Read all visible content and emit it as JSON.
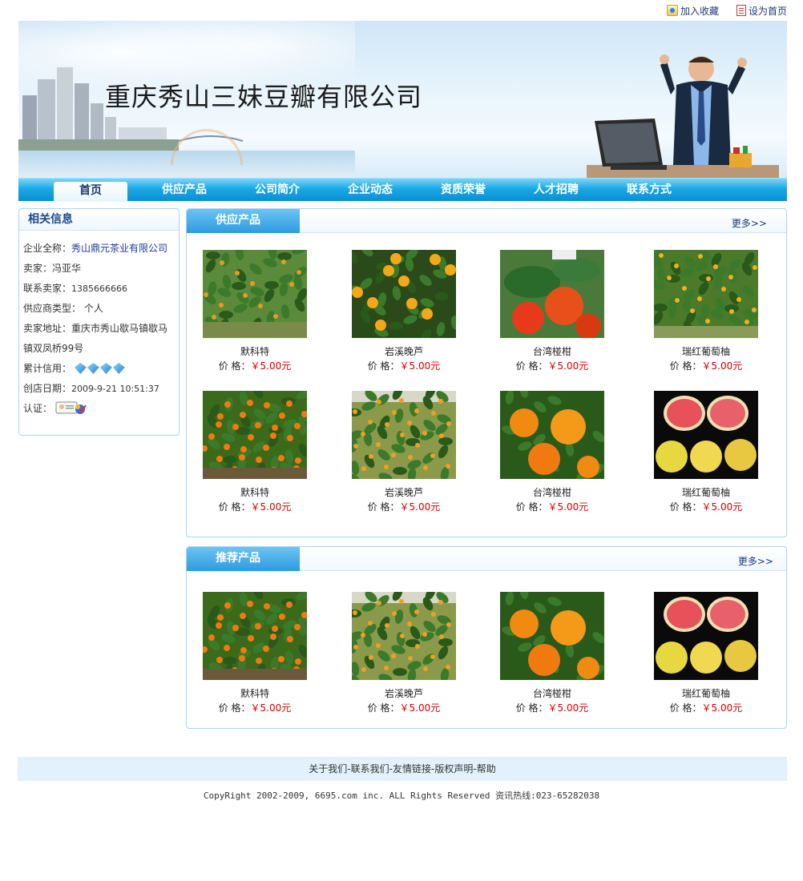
{
  "toplinks": {
    "favorite": "加入收藏",
    "homepage": "设为首页"
  },
  "banner": {
    "company_name": "重庆秀山三妹豆瓣有限公司"
  },
  "nav": [
    "首页",
    "供应产品",
    "公司简介",
    "企业动态",
    "资质荣誉",
    "人才招聘",
    "联系方式"
  ],
  "sidebar": {
    "title": "相关信息",
    "company_label": "企业全称：",
    "company_value": "秀山鼎元茶业有限公司",
    "seller_label": "卖家：",
    "seller_value": "冯亚华",
    "contact_label": "联系卖家：",
    "contact_value": "1385666666",
    "type_label": "供应商类型：",
    "type_value": "个人",
    "address_label": "卖家地址：",
    "address_value": "重庆市秀山歇马镇歇马镇双凤桥99号",
    "credit_label": "累计信用：",
    "date_label": "创店日期：",
    "date_value": "2009-9-21 10:51:37",
    "cert_label": "认证："
  },
  "supply": {
    "title": "供应产品",
    "more": "更多>>",
    "price_label": "价 格：",
    "products": [
      {
        "name": "默科特",
        "price": "￥5.00元",
        "img": "orchard-green"
      },
      {
        "name": "岩溪晚芦",
        "price": "￥5.00元",
        "img": "oranges-close"
      },
      {
        "name": "台湾椪柑",
        "price": "￥5.00元",
        "img": "red-orange-leaf"
      },
      {
        "name": "瑞红葡萄柚",
        "price": "￥5.00元",
        "img": "orchard-tree"
      },
      {
        "name": "默科特",
        "price": "￥5.00元",
        "img": "tree-orange"
      },
      {
        "name": "岩溪晚芦",
        "price": "￥5.00元",
        "img": "orchard-field"
      },
      {
        "name": "台湾椪柑",
        "price": "￥5.00元",
        "img": "big-oranges"
      },
      {
        "name": "瑞红葡萄柚",
        "price": "￥5.00元",
        "img": "grapefruit-cut"
      }
    ]
  },
  "recommend": {
    "title": "推荐产品",
    "more": "更多>>",
    "price_label": "价 格：",
    "products": [
      {
        "name": "默科特",
        "price": "￥5.00元",
        "img": "tree-orange"
      },
      {
        "name": "岩溪晚芦",
        "price": "￥5.00元",
        "img": "orchard-field"
      },
      {
        "name": "台湾椪柑",
        "price": "￥5.00元",
        "img": "big-oranges"
      },
      {
        "name": "瑞红葡萄柚",
        "price": "￥5.00元",
        "img": "grapefruit-cut"
      }
    ]
  },
  "footer": {
    "links": [
      "关于我们",
      "联系我们",
      "友情链接",
      "版权声明",
      "帮助"
    ],
    "separator": "-",
    "copyright": "CopyRight 2002-2009, 6695.com inc. ALL Rights Reserved 资讯热线:023-65282038"
  },
  "colors": {
    "nav": "#1aa8e6",
    "accent_tab": "#2d9be0",
    "price": "#d40000",
    "link": "#1a3a9a",
    "border": "#a9d6ee"
  }
}
